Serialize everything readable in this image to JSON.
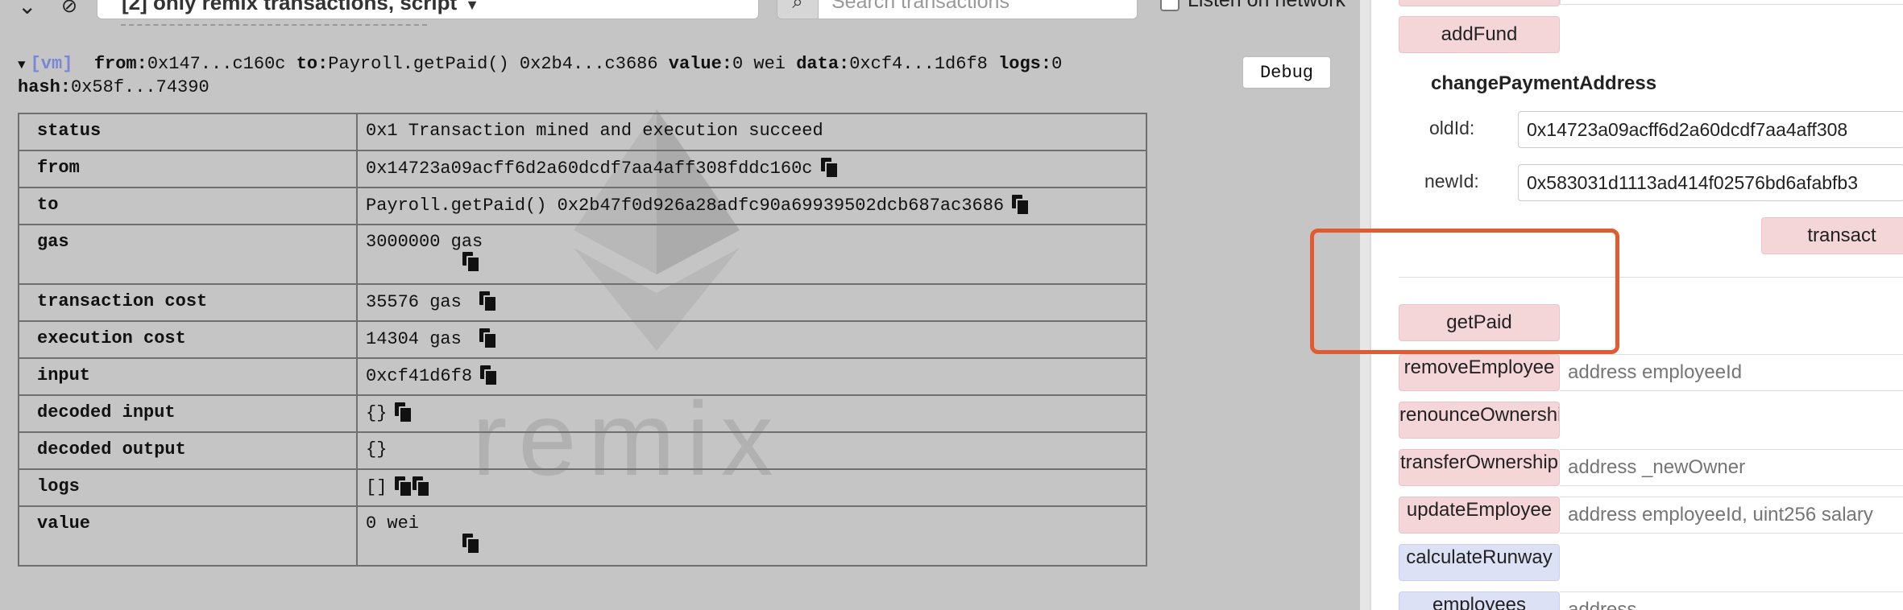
{
  "toolbar": {
    "filter_label": "[2] only remix transactions, script",
    "search_placeholder": "Search transactions",
    "listen_label": "Listen on network"
  },
  "tx_summary": {
    "vm_tag": "[vm]",
    "from_key": "from:",
    "from_val": "0x147...c160c",
    "to_key": "to:",
    "to_val": "Payroll.getPaid() 0x2b4...c3686",
    "value_key": "value:",
    "value_val": "0 wei",
    "data_key": "data:",
    "data_val": "0xcf4...1d6f8",
    "logs_key": "logs:",
    "logs_val": "0",
    "hash_key": "hash:",
    "hash_val": "0x58f...74390"
  },
  "debug_label": "Debug",
  "tx_table": {
    "status": {
      "key": "status",
      "value": "0x1 Transaction mined and execution succeed"
    },
    "from": {
      "key": "from",
      "value": "0x14723a09acff6d2a60dcdf7aa4aff308fddc160c"
    },
    "to": {
      "key": "to",
      "value": "Payroll.getPaid() 0x2b47f0d926a28adfc90a69939502dcb687ac3686"
    },
    "gas": {
      "key": "gas",
      "value": "3000000 gas"
    },
    "transaction_cost": {
      "key": "transaction cost",
      "value": "35576 gas"
    },
    "execution_cost": {
      "key": "execution cost",
      "value": "14304 gas"
    },
    "input": {
      "key": "input",
      "value": "0xcf41d6f8"
    },
    "decoded_input": {
      "key": "decoded input",
      "value": "{}"
    },
    "decoded_output": {
      "key": "decoded output",
      "value": "{}"
    },
    "logs": {
      "key": "logs",
      "value": "[]"
    },
    "value": {
      "key": "value",
      "value": "0 wei"
    }
  },
  "watermark": {
    "text": "remix"
  },
  "run_panel": {
    "addFund": "addFund",
    "change_title": "changePaymentAddress",
    "oldId_label": "oldId:",
    "oldId_value": "0x14723a09acff6d2a60dcdf7aa4aff308",
    "newId_label": "newId:",
    "newId_value": "0x583031d1113ad414f02576bd6afabfb3",
    "transact": "transact",
    "getPaid": "getPaid",
    "removeEmployee": "removeEmployee",
    "removeEmployee_placeholder": "address employeeId",
    "renounceOwnership": "renounceOwnership",
    "transferOwnership": "transferOwnership",
    "transferOwnership_placeholder": "address _newOwner",
    "updateEmployee": "updateEmployee",
    "updateEmployee_placeholder": "address employeeId, uint256 salary",
    "calculateRunway": "calculateRunway",
    "employees": "employees",
    "employees_placeholder": "address"
  },
  "colors": {
    "terminal_bg": "#c5c5c5",
    "transact_button": "#f4d5d8",
    "call_button": "#dde1f5",
    "highlight": "#e25a30"
  }
}
